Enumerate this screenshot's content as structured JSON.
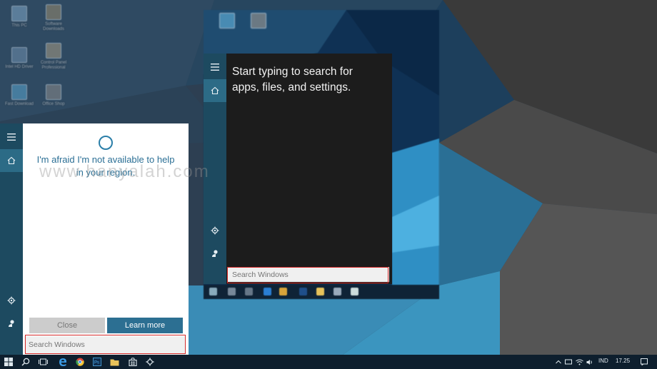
{
  "colors": {
    "rail": "#1d4a60",
    "rail_active": "#2c6b86",
    "accent": "#2c6f92",
    "cortana_text": "#2b6f95",
    "highlight_box": "#d42a2a",
    "taskbar": "#0e1f2e"
  },
  "desktop": {
    "icons": [
      {
        "label": "This PC",
        "icon": "computer-icon"
      },
      {
        "label": "Software Downloads",
        "icon": "folder-icon"
      },
      {
        "label": "Intel HD Driver",
        "icon": "folder-icon"
      },
      {
        "label": "Control Panel Professional",
        "icon": "folder-icon"
      },
      {
        "label": "Fast Download",
        "icon": "download-icon"
      },
      {
        "label": "Office Shop",
        "icon": "folder-icon"
      }
    ]
  },
  "start_menu": {
    "prompt": "Start typing to search for apps, files, and settings.",
    "search_placeholder": "Search Windows",
    "rail_icons": [
      "hamburger-icon",
      "home-icon",
      "gear-icon",
      "user-icon"
    ]
  },
  "cortana": {
    "message": "I'm afraid I'm not available to help in your region.",
    "close_label": "Close",
    "learn_more_label": "Learn more",
    "search_placeholder": "Search Windows",
    "rail_icons": [
      "hamburger-icon",
      "home-icon",
      "gear-icon",
      "user-icon"
    ]
  },
  "watermark": "www.hanyalah.com",
  "taskbar": {
    "pinned": [
      "windows-start-icon",
      "search-icon",
      "task-view-icon",
      "edge-icon",
      "chrome-icon",
      "photoshop-icon",
      "file-explorer-icon",
      "store-icon",
      "settings-icon"
    ],
    "tray": {
      "language": "IND",
      "time": "17.25"
    }
  }
}
